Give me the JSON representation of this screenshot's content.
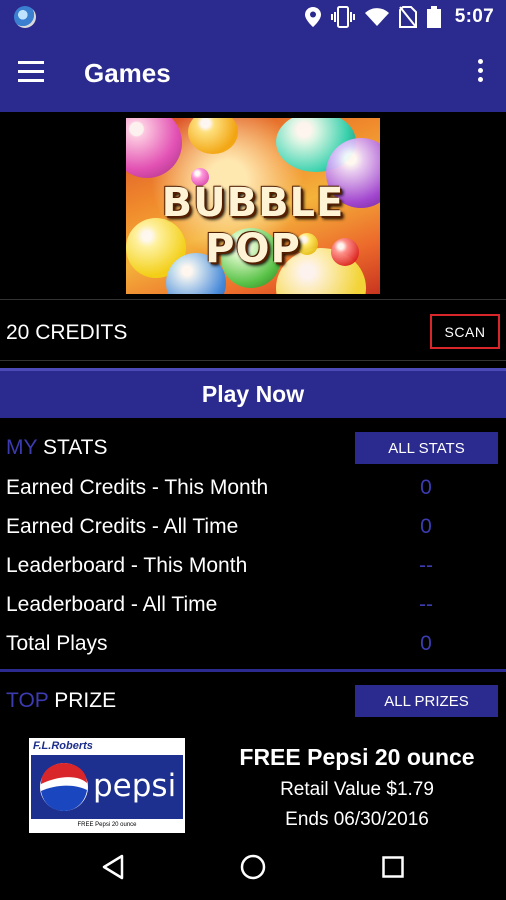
{
  "status_bar": {
    "time": "5:07"
  },
  "app_bar": {
    "title": "Games"
  },
  "banner": {
    "game_title": "BUBBLE POP"
  },
  "credits": {
    "text": "20 CREDITS",
    "scan_label": "SCAN"
  },
  "play": {
    "label": "Play Now"
  },
  "my_stats": {
    "title_accent": "MY",
    "title_rest": " STATS",
    "all_button": "ALL STATS",
    "rows": [
      {
        "label": "Earned Credits - This Month",
        "value": "0"
      },
      {
        "label": "Earned Credits - All Time",
        "value": "0"
      },
      {
        "label": "Leaderboard - This Month",
        "value": "--"
      },
      {
        "label": "Leaderboard - All Time",
        "value": "--"
      },
      {
        "label": "Total Plays",
        "value": "0"
      }
    ]
  },
  "top_prize": {
    "title_accent": "TOP",
    "title_rest": " PRIZE",
    "all_button": "ALL PRIZES",
    "image": {
      "store": "F.L.Roberts",
      "brand": "pepsi",
      "caption": "FREE Pepsi 20 ounce"
    },
    "name": "FREE Pepsi 20 ounce",
    "retail": "Retail Value $1.79",
    "ends": "Ends 06/30/2016"
  },
  "colors": {
    "primary": "#2b2a8e",
    "accent_text": "#3c3bb0",
    "scan_border": "#d8262b",
    "background": "#000000"
  }
}
